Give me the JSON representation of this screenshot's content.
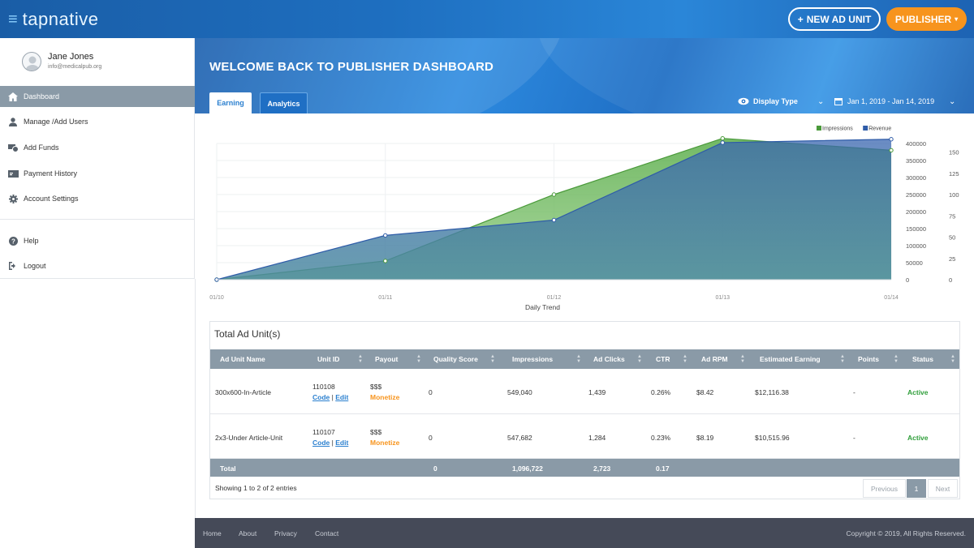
{
  "header": {
    "brand": "tapnative",
    "new_ad_unit": "NEW AD UNIT",
    "publisher": "PUBLISHER"
  },
  "user": {
    "name": "Jane Jones",
    "email": "info@medicalpub.org"
  },
  "sidebar": {
    "items": [
      {
        "label": "Dashboard",
        "icon": "home-icon"
      },
      {
        "label": "Manage /Add Users",
        "icon": "user-icon"
      },
      {
        "label": "Add Funds",
        "icon": "funds-icon"
      },
      {
        "label": "Payment History",
        "icon": "payment-icon"
      },
      {
        "label": "Account Settings",
        "icon": "gear-icon"
      },
      {
        "label": "Help",
        "icon": "help-icon"
      },
      {
        "label": "Logout",
        "icon": "logout-icon"
      }
    ]
  },
  "page": {
    "title": "WELCOME BACK TO PUBLISHER DASHBOARD"
  },
  "tabs": [
    "Earning",
    "Analytics"
  ],
  "filters": {
    "display_type": "Display Type",
    "date_range": "Jan 1, 2019 - Jan 14, 2019"
  },
  "chart_data": {
    "type": "area",
    "categories": [
      "01/10",
      "01/11",
      "01/12",
      "01/13",
      "01/14"
    ],
    "xlabel": "Daily Trend",
    "series": [
      {
        "name": "Impressions",
        "axis": "left",
        "color": "#4a9a3a",
        "values": [
          0,
          55000,
          250000,
          415000,
          380000
        ]
      },
      {
        "name": "Revenue",
        "axis": "right",
        "color": "#2f5ca8",
        "values": [
          0,
          52,
          70,
          161,
          165
        ]
      }
    ],
    "y_left": {
      "ticks": [
        "0",
        "50000",
        "100000",
        "150000",
        "200000",
        "250000",
        "300000",
        "350000",
        "400000"
      ],
      "ylim": [
        0,
        400000
      ]
    },
    "y_right": {
      "ticks": [
        "0",
        "25",
        "50",
        "75",
        "100",
        "125",
        "150"
      ],
      "ylim": [
        0,
        160
      ]
    },
    "legend": "top-right",
    "grid": true
  },
  "table": {
    "title": "Total Ad Unit(s)",
    "columns": [
      "Ad Unit Name",
      "Unit ID",
      "Payout",
      "Quality Score",
      "Impressions",
      "Ad Clicks",
      "CTR",
      "Ad RPM",
      "Estimated Earning",
      "Points",
      "Status"
    ],
    "rows": [
      {
        "name": "300x600-In-Article",
        "unit_id": "110108",
        "code": "Code",
        "sep": "|",
        "edit": "Edit",
        "payout": "$$$",
        "monetize": "Monetize",
        "quality": "0",
        "impressions": "549,040",
        "clicks": "1,439",
        "ctr": "0.26%",
        "rpm": "$8.42",
        "earning": "$12,116.38",
        "points": "-",
        "status": "Active"
      },
      {
        "name": "2x3-Under Article-Unit",
        "unit_id": "110107",
        "code": "Code",
        "sep": "|",
        "edit": "Edit",
        "payout": "$$$",
        "monetize": "Monetize",
        "quality": "0",
        "impressions": "547,682",
        "clicks": "1,284",
        "ctr": "0.23%",
        "rpm": "$8.19",
        "earning": "$10,515.96",
        "points": "-",
        "status": "Active"
      }
    ],
    "total": {
      "label": "Total",
      "quality": "0",
      "impressions": "1,096,722",
      "clicks": "2,723",
      "ctr": "0.17"
    },
    "showing": "Showing 1 to 2 of 2 entries",
    "pagination": {
      "previous": "Previous",
      "current": "1",
      "next": "Next"
    }
  },
  "footer": {
    "links": [
      "Home",
      "About",
      "Privacy",
      "Contact"
    ],
    "copyright": "Copyright © 2019, All Rights Reserved."
  },
  "colors": {
    "accent": "#2a7fcf",
    "orange": "#f7941d",
    "header_gray": "#8a9aa7",
    "footer": "#454a58",
    "active": "#2f9e3a"
  }
}
